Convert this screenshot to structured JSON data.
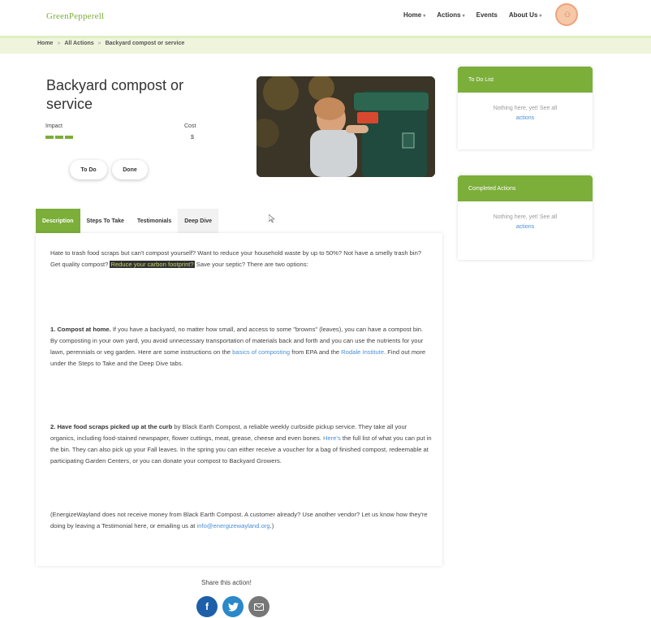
{
  "brand": {
    "logo_a": "Green",
    "logo_b": "Pepperell"
  },
  "nav": {
    "items": [
      {
        "label": "Home",
        "has_caret": true
      },
      {
        "label": "Actions",
        "has_caret": true
      },
      {
        "label": "Events",
        "has_caret": false
      },
      {
        "label": "About Us",
        "has_caret": true
      }
    ],
    "avatar_icon": "user-icon"
  },
  "breadcrumb": {
    "items": [
      "Home",
      "All Actions",
      "Backyard compost or service"
    ],
    "separator": "»"
  },
  "action": {
    "title": "Backyard compost or service",
    "impact_label": "Impact",
    "impact_level": 3,
    "cost_label": "Cost",
    "cost_value": "$",
    "todo_label": "To Do",
    "done_label": "Done"
  },
  "tabs": [
    {
      "label": "Description",
      "active": true
    },
    {
      "label": "Steps To Take",
      "active": false
    },
    {
      "label": "Testimonials",
      "active": false
    },
    {
      "label": "Deep Dive",
      "active": false
    }
  ],
  "content": {
    "intro": "Hate to trash food scraps but can't compost yourself? Want to reduce your household waste by up to 50%? Not have a smelly trash bin? Get quality compost?",
    "intro_highlight": "Reduce your carbon footprint?",
    "intro_end": "Save your septic? There are two options:",
    "opt1_title": "1. Compost at home.",
    "opt1_text": "If you have a backyard, no matter how small, and access to some \"browns\" (leaves), you can have a compost bin. By composting in your own yard, you avoid unnecessary transportation of materials back and forth and you can use the nutrients for your lawn, perennials or veg garden. Here are some instructions on the",
    "opt1_link1": "basics of composting",
    "opt1_mid": "from EPA and the",
    "opt1_link2": "Rodale Institute",
    "opt1_end": ". Find out more under the Steps to Take and the Deep Dive tabs.",
    "opt2_title": "2. Have food scraps picked up at the curb",
    "opt2_text": "by Black Earth Compost, a reliable weekly curbside pickup service. They take all your organics, including food-stained newspaper, flower cuttings, meat, grease, cheese and even bones.",
    "opt2_link": "Here's",
    "opt2_end": "the full list of what you can put in the bin. They can also pick up your Fall leaves. In the spring you can either receive a voucher for a bag of finished compost, redeemable at participating Garden Centers, or you can donate your compost to Backyard Growers.",
    "note": "(EnergizeWayland does not receive money from Black Earth Compost. A customer already? Use another vendor? Let us know how they're doing by leaving a Testimonial here, or emailing us at",
    "note_link": "info@energizewayland.org",
    "note_end": ".)"
  },
  "share": {
    "label": "Share this action!",
    "icons": [
      "facebook-icon",
      "twitter-icon",
      "email-icon"
    ]
  },
  "sidebar": {
    "todo": {
      "title": "To Do List",
      "empty": "Nothing here, yet! See all",
      "link": "actions"
    },
    "completed": {
      "title": "Completed Actions",
      "empty": "Nothing here, yet! See all",
      "link": "actions"
    }
  },
  "colors": {
    "accent": "#7cae3a",
    "link": "#4a8fd8",
    "breadcrumb_bg": "#eef5dc"
  }
}
